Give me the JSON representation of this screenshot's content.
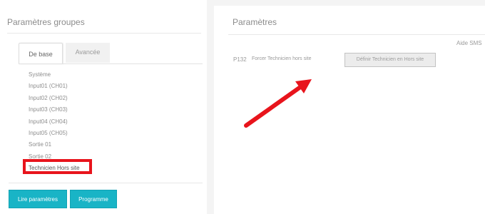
{
  "left_panel": {
    "title": "Paramètres groupes",
    "tabs": [
      {
        "label": "De base",
        "selected": true
      },
      {
        "label": "Avancée",
        "selected": false
      }
    ],
    "groups": [
      "Système",
      "Input01 (CH01)",
      "Input02 (CH02)",
      "Input03 (CH03)",
      "Input04 (CH04)",
      "Input05 (CH05)",
      "Sortie 01",
      "Sortie 02",
      "Technicien Hors site"
    ],
    "highlighted_group": "Technicien Hors site",
    "buttons": {
      "read_params": "Lire paramètres",
      "program": "Programme"
    }
  },
  "right_panel": {
    "title": "Paramètres",
    "sms_help": "Aide SMS",
    "param": {
      "code": "P132",
      "label": "Forcer Technicien hors site",
      "button": "Définir Technicien en Hors site"
    }
  },
  "colors": {
    "accent": "#19b4c6",
    "highlight": "#e8141c",
    "arrow": "#e8141c"
  },
  "annotation": {
    "arrow_icon": "red-arrow-icon"
  }
}
